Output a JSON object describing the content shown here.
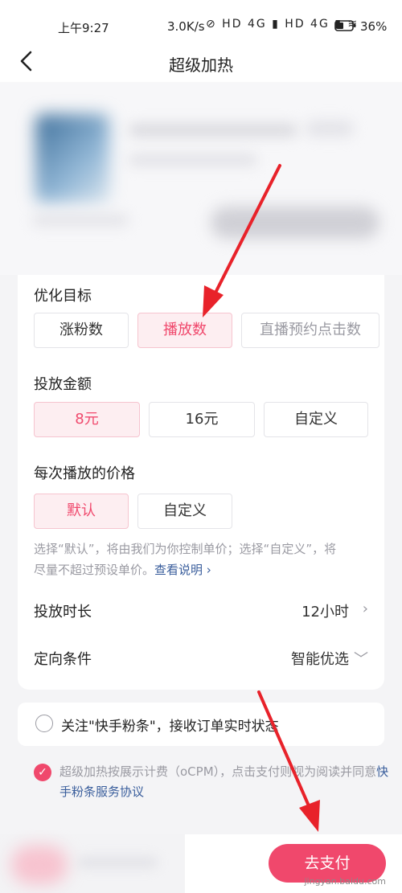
{
  "status": {
    "time": "上午9:27",
    "speed": "3.0K/s",
    "icons": "⊘ HD 4G ▮ HD 4G ▮ ≋",
    "battery": "36%"
  },
  "nav": {
    "title": "超级加热"
  },
  "optimize": {
    "title": "优化目标",
    "options": [
      "涨粉数",
      "播放数",
      "直播预约点击数"
    ],
    "selected": "播放数"
  },
  "amount": {
    "title": "投放金额",
    "options": [
      "8元",
      "16元",
      "自定义"
    ],
    "selected": "8元"
  },
  "price": {
    "title": "每次播放的价格",
    "options": [
      "默认",
      "自定义"
    ],
    "selected": "默认",
    "hint": "选择“默认”，将由我们为你控制单价；选择“自定义”，将尽量不超过预设单价。",
    "hint_link": "查看说明 ›"
  },
  "duration": {
    "label": "投放时长",
    "value": "12小时",
    "chevron": "›"
  },
  "targeting": {
    "label": "定向条件",
    "value": "智能优选",
    "chevron": "﹀"
  },
  "follow": {
    "text": "关注\"快手粉条\"，接收订单实时状态",
    "checked": false
  },
  "agreement": {
    "text": "超级加热按展示计费（oCPM），点击支付则视为阅读并同意",
    "link": "快手粉条服务协议",
    "checked": true
  },
  "pay": {
    "label": "去支付"
  },
  "watermark": "jingyan.baidu.com",
  "colors": {
    "accent": "#f0486c",
    "link": "#3a5e9c",
    "arrow": "#e8222a"
  }
}
